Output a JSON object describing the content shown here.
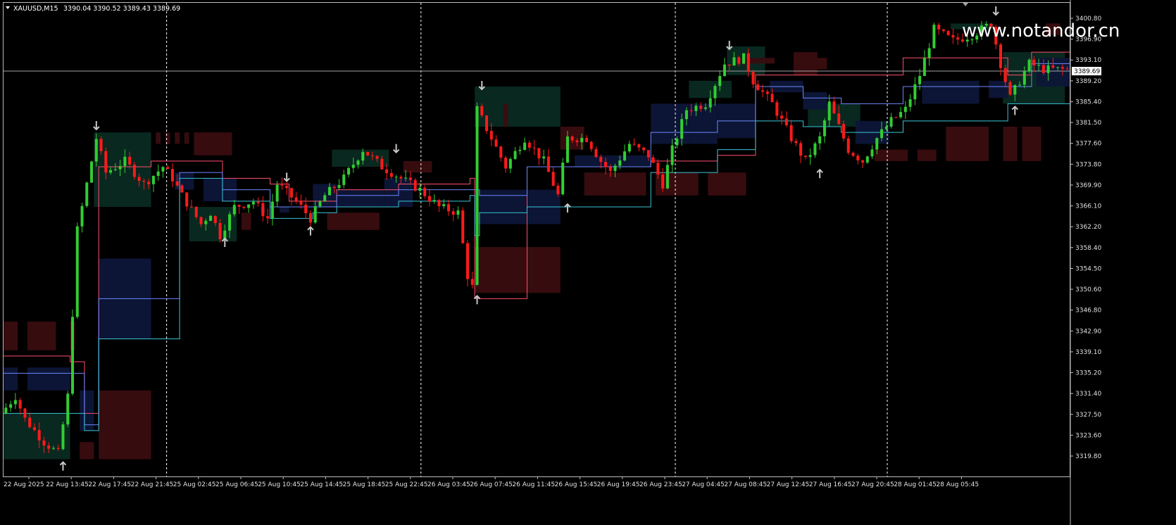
{
  "header": {
    "symbol_timeframe": "XAUUSD,M15",
    "ohlc": "3390.04 3390.52 3389.43 3389.69"
  },
  "watermark": "www.notandor.cn",
  "current_price_label": "3389.69",
  "colors": {
    "background": "#000000",
    "bull": "#32cd32",
    "bear": "#ff1a1a",
    "grid": "#ffffff",
    "axis_text": "#e0e0e0",
    "resistance_line": "#ff4d6d",
    "support_line": "#38c5d8",
    "mid_line": "#6b86ff"
  },
  "chart_data": {
    "type": "candlestick",
    "y_ticks": [
      "3400.80",
      "3396.90",
      "3393.10",
      "3389.20",
      "3385.40",
      "3381.50",
      "3377.60",
      "3373.80",
      "3369.90",
      "3366.10",
      "3362.20",
      "3358.40",
      "3354.50",
      "3350.60",
      "3346.80",
      "3342.90",
      "3339.10",
      "3335.20",
      "3331.40",
      "3327.50",
      "3323.60",
      "3319.80"
    ],
    "x_ticks": [
      "22 Aug 2025",
      "22 Aug 13:45",
      "22 Aug 17:45",
      "22 Aug 21:45",
      "25 Aug 02:45",
      "25 Aug 06:45",
      "25 Aug 10:45",
      "25 Aug 14:45",
      "25 Aug 18:45",
      "25 Aug 22:45",
      "26 Aug 03:45",
      "26 Aug 07:45",
      "26 Aug 11:45",
      "26 Aug 15:45",
      "26 Aug 19:45",
      "26 Aug 23:45",
      "27 Aug 04:45",
      "27 Aug 08:45",
      "27 Aug 12:45",
      "27 Aug 16:45",
      "27 Aug 20:45",
      "28 Aug 01:45",
      "28 Aug 05:45"
    ],
    "y_range": [
      3319.0,
      3401.6
    ],
    "current_price": 3389.69,
    "day_separators_after": [
      "22 Aug 21:45",
      "25 Aug 22:45",
      "26 Aug 23:45",
      "27 Aug 20:45"
    ],
    "path": [
      [
        0,
        3330
      ],
      [
        3,
        3333
      ],
      [
        5,
        3329
      ],
      [
        9,
        3325
      ],
      [
        12,
        3323
      ],
      [
        14,
        3333
      ],
      [
        16,
        3362
      ],
      [
        18,
        3370
      ],
      [
        20,
        3378
      ],
      [
        22,
        3372
      ],
      [
        26,
        3374
      ],
      [
        30,
        3370
      ],
      [
        34,
        3373
      ],
      [
        36,
        3371
      ],
      [
        38,
        3368
      ],
      [
        42,
        3363
      ],
      [
        44,
        3365
      ],
      [
        46,
        3361
      ],
      [
        49,
        3366
      ],
      [
        53,
        3367
      ],
      [
        56,
        3364
      ],
      [
        58,
        3370
      ],
      [
        62,
        3367
      ],
      [
        65,
        3364
      ],
      [
        68,
        3368
      ],
      [
        72,
        3371
      ],
      [
        76,
        3376
      ],
      [
        80,
        3373
      ],
      [
        84,
        3371
      ],
      [
        88,
        3369
      ],
      [
        92,
        3366
      ],
      [
        96,
        3365
      ],
      [
        98,
        3354
      ],
      [
        99,
        3352
      ],
      [
        100,
        3383
      ],
      [
        103,
        3378
      ],
      [
        106,
        3373
      ],
      [
        110,
        3378
      ],
      [
        114,
        3374
      ],
      [
        117,
        3368
      ],
      [
        119,
        3378
      ],
      [
        123,
        3378
      ],
      [
        126,
        3374
      ],
      [
        128,
        3372
      ],
      [
        132,
        3377
      ],
      [
        136,
        3375
      ],
      [
        139,
        3370
      ],
      [
        141,
        3376
      ],
      [
        144,
        3383
      ],
      [
        148,
        3384
      ],
      [
        152,
        3391
      ],
      [
        156,
        3392
      ],
      [
        158,
        3388
      ],
      [
        162,
        3384
      ],
      [
        166,
        3378
      ],
      [
        169,
        3374
      ],
      [
        172,
        3378
      ],
      [
        174,
        3384
      ],
      [
        178,
        3376
      ],
      [
        181,
        3374
      ],
      [
        184,
        3378
      ],
      [
        187,
        3381
      ],
      [
        190,
        3383
      ],
      [
        193,
        3389
      ],
      [
        196,
        3397
      ],
      [
        200,
        3395
      ],
      [
        204,
        3396
      ],
      [
        206,
        3397
      ],
      [
        208,
        3398
      ],
      [
        210,
        3391
      ],
      [
        212,
        3385
      ],
      [
        214,
        3388
      ],
      [
        216,
        3391
      ],
      [
        219,
        3390
      ]
    ],
    "fractal_down_arrows": [
      [
        19,
        3380
      ],
      [
        59,
        3371
      ],
      [
        82,
        3376
      ],
      [
        100,
        3387
      ],
      [
        152,
        3394
      ],
      [
        208,
        3400
      ]
    ],
    "fractal_up_arrows": [
      [
        12,
        3321
      ],
      [
        46,
        3360
      ],
      [
        64,
        3362
      ],
      [
        99,
        3350
      ],
      [
        118,
        3366
      ],
      [
        171,
        3372
      ],
      [
        212,
        3383
      ]
    ],
    "zones": {
      "green": [
        [
          0,
          3330,
          14,
          3322
        ],
        [
          19,
          3379,
          31,
          3366
        ],
        [
          39,
          3366,
          49,
          3360
        ],
        [
          69,
          3376,
          81,
          3373
        ],
        [
          99,
          3387,
          117,
          3380
        ],
        [
          144,
          3388,
          153,
          3385
        ],
        [
          152,
          3394,
          160,
          3389
        ],
        [
          169,
          3384,
          180,
          3380
        ],
        [
          199,
          3398,
          208,
          3397
        ],
        [
          210,
          3393,
          223,
          3384
        ]
      ],
      "red": [
        [
          0,
          3346,
          3,
          3341
        ],
        [
          5,
          3346,
          11,
          3341
        ],
        [
          14,
          3346,
          15,
          3341
        ],
        [
          20,
          3334,
          31,
          3322
        ],
        [
          16,
          3325,
          19,
          3322
        ],
        [
          32,
          3379,
          33,
          3377
        ],
        [
          34,
          3379,
          35,
          3377
        ],
        [
          36,
          3379,
          37,
          3377
        ],
        [
          38,
          3379,
          39,
          3377
        ],
        [
          40,
          3379,
          48,
          3375
        ],
        [
          50,
          3365,
          52,
          3362
        ],
        [
          68,
          3365,
          79,
          3362
        ],
        [
          84,
          3374,
          90,
          3372
        ],
        [
          99,
          3359,
          117,
          3351
        ],
        [
          105,
          3384,
          106,
          3380
        ],
        [
          117,
          3380,
          122,
          3376
        ],
        [
          122,
          3372,
          128,
          3368
        ],
        [
          128,
          3372,
          135,
          3368
        ],
        [
          137,
          3372,
          146,
          3368
        ],
        [
          148,
          3372,
          156,
          3368
        ],
        [
          156,
          3392,
          162,
          3391
        ],
        [
          166,
          3393,
          171,
          3389
        ],
        [
          171,
          3392,
          173,
          3390
        ],
        [
          183,
          3376,
          186,
          3374
        ],
        [
          186,
          3376,
          190,
          3374
        ],
        [
          192,
          3376,
          196,
          3374
        ],
        [
          198,
          3380,
          207,
          3374
        ],
        [
          210,
          3380,
          213,
          3374
        ],
        [
          214,
          3380,
          218,
          3374
        ],
        [
          219,
          3398,
          222,
          3396
        ]
      ],
      "navy": [
        [
          0,
          3338,
          3,
          3334
        ],
        [
          5,
          3338,
          14,
          3334
        ],
        [
          16,
          3334,
          19,
          3327
        ],
        [
          20,
          3357,
          31,
          3343
        ],
        [
          36,
          3372,
          38,
          3369
        ],
        [
          38,
          3372,
          40,
          3369
        ],
        [
          42,
          3371,
          49,
          3367
        ],
        [
          54,
          3366,
          55,
          3365
        ],
        [
          58,
          3366,
          60,
          3365
        ],
        [
          65,
          3370,
          70,
          3366
        ],
        [
          70,
          3369,
          80,
          3366
        ],
        [
          80,
          3371,
          86,
          3366
        ],
        [
          99,
          3369,
          117,
          3363
        ],
        [
          120,
          3375,
          131,
          3373
        ],
        [
          131,
          3375,
          136,
          3373
        ],
        [
          136,
          3384,
          144,
          3377
        ],
        [
          144,
          3384,
          150,
          3377
        ],
        [
          150,
          3384,
          158,
          3378
        ],
        [
          161,
          3388,
          168,
          3386
        ],
        [
          168,
          3386,
          173,
          3383
        ],
        [
          179,
          3381,
          186,
          3377
        ],
        [
          193,
          3388,
          205,
          3384
        ],
        [
          207,
          3388,
          211,
          3385
        ],
        [
          217,
          3392,
          224,
          3387
        ]
      ]
    },
    "resistance_steps": [
      [
        0,
        3340
      ],
      [
        14,
        3339
      ],
      [
        17,
        3330
      ],
      [
        20,
        3373
      ],
      [
        31,
        3374
      ],
      [
        37,
        3374
      ],
      [
        46,
        3371
      ],
      [
        56,
        3370
      ],
      [
        60,
        3367
      ],
      [
        70,
        3369
      ],
      [
        83,
        3370
      ],
      [
        98,
        3371
      ],
      [
        99,
        3350
      ],
      [
        110,
        3373
      ],
      [
        136,
        3374
      ],
      [
        150,
        3375
      ],
      [
        158,
        3389
      ],
      [
        168,
        3389
      ],
      [
        176,
        3389
      ],
      [
        189,
        3392
      ],
      [
        211,
        3389
      ],
      [
        216,
        3393
      ],
      [
        224,
        3393
      ]
    ],
    "mid_steps": [
      [
        0,
        3337
      ],
      [
        14,
        3337
      ],
      [
        17,
        3328
      ],
      [
        20,
        3350
      ],
      [
        31,
        3350
      ],
      [
        37,
        3372
      ],
      [
        46,
        3369
      ],
      [
        56,
        3366
      ],
      [
        65,
        3366
      ],
      [
        70,
        3368
      ],
      [
        83,
        3369
      ],
      [
        98,
        3369
      ],
      [
        100,
        3368
      ],
      [
        110,
        3373
      ],
      [
        136,
        3379
      ],
      [
        150,
        3381
      ],
      [
        158,
        3387
      ],
      [
        168,
        3385
      ],
      [
        176,
        3384
      ],
      [
        189,
        3387
      ],
      [
        211,
        3387
      ],
      [
        216,
        3391
      ],
      [
        224,
        3391
      ]
    ],
    "support_steps": [
      [
        0,
        3330
      ],
      [
        14,
        3330
      ],
      [
        17,
        3327
      ],
      [
        20,
        3343
      ],
      [
        31,
        3343
      ],
      [
        37,
        3371
      ],
      [
        46,
        3367
      ],
      [
        56,
        3364
      ],
      [
        65,
        3365
      ],
      [
        70,
        3366
      ],
      [
        83,
        3367
      ],
      [
        98,
        3368
      ],
      [
        99,
        3361
      ],
      [
        100,
        3365
      ],
      [
        110,
        3366
      ],
      [
        136,
        3372
      ],
      [
        150,
        3376
      ],
      [
        158,
        3381
      ],
      [
        168,
        3380
      ],
      [
        176,
        3379
      ],
      [
        189,
        3381
      ],
      [
        211,
        3384
      ],
      [
        224,
        3384
      ]
    ]
  }
}
